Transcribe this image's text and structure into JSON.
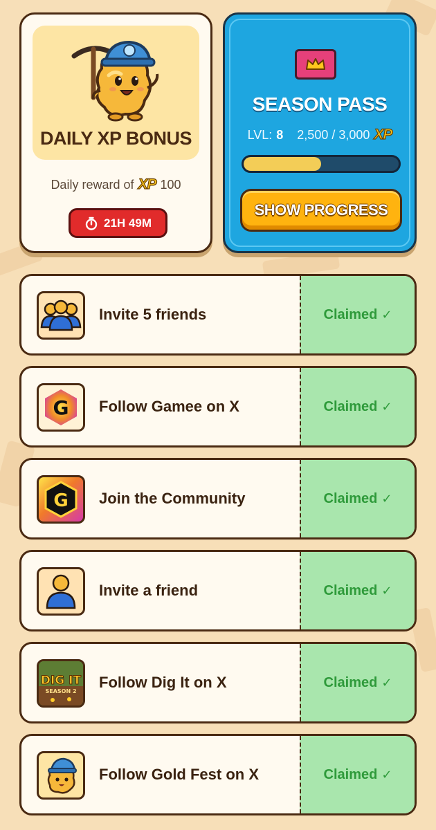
{
  "daily_bonus": {
    "title": "DAILY XP BONUS",
    "reward_prefix": "Daily reward of",
    "reward_currency": "XP",
    "reward_amount": "100",
    "timer": "21H 49M"
  },
  "season_pass": {
    "title": "SEASON PASS",
    "level_label": "LVL:",
    "level_value": "8",
    "xp_progress": "2,500 / 3,000",
    "xp_label": "XP",
    "progress_fraction": 0.5,
    "button_label": "SHOW PROGRESS"
  },
  "quests": [
    {
      "label": "Invite 5 friends",
      "status": "Claimed",
      "icon": "group-icon"
    },
    {
      "label": "Follow Gamee on X",
      "status": "Claimed",
      "icon": "gamee-logo-icon"
    },
    {
      "label": "Join the Community",
      "status": "Claimed",
      "icon": "gamee-community-icon"
    },
    {
      "label": "Invite a friend",
      "status": "Claimed",
      "icon": "person-icon"
    },
    {
      "label": "Follow Dig It on X",
      "status": "Claimed",
      "icon": "dig-it-logo-icon"
    },
    {
      "label": "Follow Gold Fest on X",
      "status": "Claimed",
      "icon": "gold-mascot-icon"
    }
  ],
  "colors": {
    "background": "#f7dfb8",
    "season_blue": "#1ea6e0",
    "claimed_green": "#a9e6ad",
    "timer_red": "#e12b2b",
    "button_orange": "#ffb30f"
  },
  "misc": {
    "dig_it_logo_text": "DIG IT",
    "dig_it_logo_sub": "SEASON 2"
  }
}
